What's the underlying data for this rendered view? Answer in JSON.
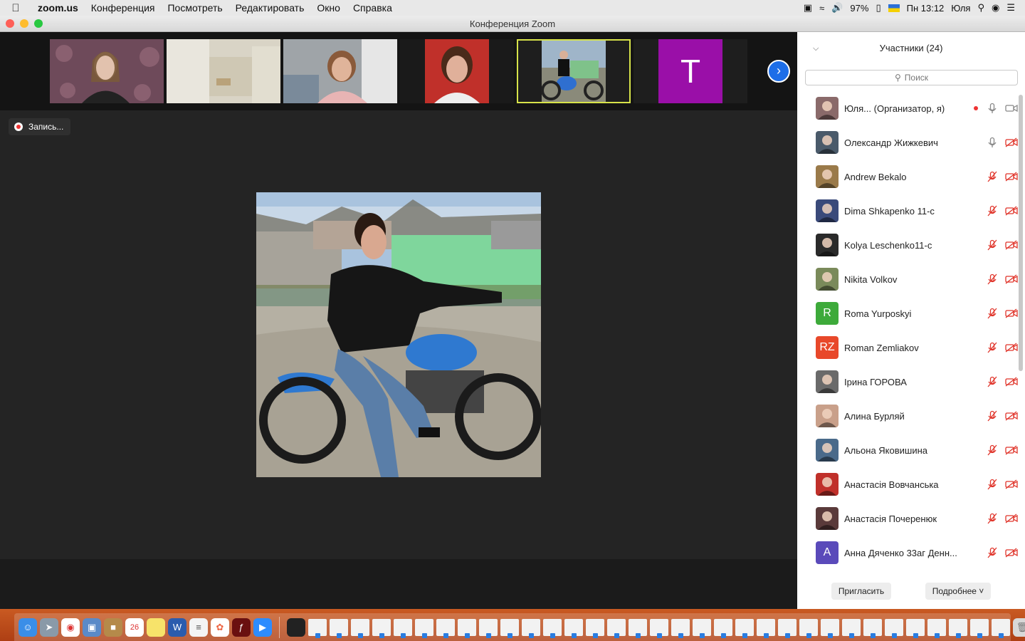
{
  "menubar": {
    "app": "zoom.us",
    "items": [
      "Конференция",
      "Посмотреть",
      "Редактировать",
      "Окно",
      "Справка"
    ],
    "battery": "97%",
    "clock": "Пн 13:12",
    "user": "Юля"
  },
  "window": {
    "title": "Конференция Zoom"
  },
  "gallery": {
    "tile_letter": "T",
    "next_icon": "chevron-right-icon"
  },
  "recording": {
    "label": "Запись..."
  },
  "participants": {
    "title": "Участники (24)",
    "search_placeholder": "Поиск",
    "list": [
      {
        "name": "Юля...   (Организатор, я)",
        "avatar": "photo",
        "color": "#8a6a6a",
        "muted": false,
        "video": true,
        "recording": true
      },
      {
        "name": "Олександр Жижкевич",
        "avatar": "photo",
        "color": "#4a5a6a",
        "muted": false,
        "video": false
      },
      {
        "name": "Andrew Bekalo",
        "avatar": "photo",
        "color": "#9a7a4a",
        "muted": true,
        "video": false
      },
      {
        "name": "Dima Shkapenko 11-c",
        "avatar": "photo",
        "color": "#3a4a7a",
        "muted": true,
        "video": false
      },
      {
        "name": "Kolya Leschenko11-c",
        "avatar": "photo",
        "color": "#2a2a2a",
        "muted": true,
        "video": false
      },
      {
        "name": "Nikita Volkov",
        "avatar": "photo",
        "color": "#7a8a5a",
        "muted": true,
        "video": false
      },
      {
        "name": "Roma Yurposkyi",
        "avatar": "letter",
        "letter": "R",
        "color": "#3daa3a",
        "muted": true,
        "video": false
      },
      {
        "name": "Roman Zemliakov",
        "avatar": "letter",
        "letter": "RZ",
        "color": "#e8482a",
        "muted": true,
        "video": false
      },
      {
        "name": "Ірина ГОРОВА",
        "avatar": "photo",
        "color": "#6a6a6a",
        "muted": true,
        "video": false
      },
      {
        "name": "Алина Бурляй",
        "avatar": "photo",
        "color": "#c9a08a",
        "muted": true,
        "video": false
      },
      {
        "name": "Альона Яковишина",
        "avatar": "photo",
        "color": "#4a6a8a",
        "muted": true,
        "video": false
      },
      {
        "name": "Анастасія Вовчанська",
        "avatar": "photo",
        "color": "#c0302a",
        "muted": true,
        "video": false
      },
      {
        "name": "Анастасія Почеренюк",
        "avatar": "photo",
        "color": "#5a3a3a",
        "muted": true,
        "video": false
      },
      {
        "name": "Анна Дяченко 33аг Денн...",
        "avatar": "letter",
        "letter": "А",
        "color": "#5a4aba",
        "muted": true,
        "video": false
      }
    ],
    "invite_label": "Пригласить",
    "more_label": "Подробнее"
  },
  "colors": {
    "active_tile": "#d7e34a",
    "accent": "#1d6ee8",
    "muted_icon": "#e0342a"
  }
}
